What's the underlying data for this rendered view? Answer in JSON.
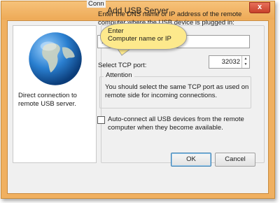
{
  "window": {
    "title": "Add USB Server",
    "close_glyph": "x"
  },
  "left_panel": {
    "icon": "globe-icon",
    "text": "Direct connection to remote USB server."
  },
  "group": {
    "caption": "Conn",
    "description": "Enter the DNS name or IP address of the remote computer where the USB device is plugged in:",
    "host_value": "192.168.1.201"
  },
  "port": {
    "label": "Select TCP port:",
    "value": "32032"
  },
  "attention": {
    "caption": "Attention",
    "text": "You should select the same TCP port as used on remote side for incoming connections."
  },
  "auto_connect": {
    "label": "Auto-connect all USB devices from the remote computer when they become available.",
    "checked": false
  },
  "buttons": {
    "ok": "OK",
    "cancel": "Cancel"
  },
  "tooltip": {
    "line1": "Enter",
    "line2": "Computer name or IP"
  },
  "colors": {
    "frame": "#f0b060",
    "tooltip": "#fde98c",
    "close": "#c7402a"
  }
}
